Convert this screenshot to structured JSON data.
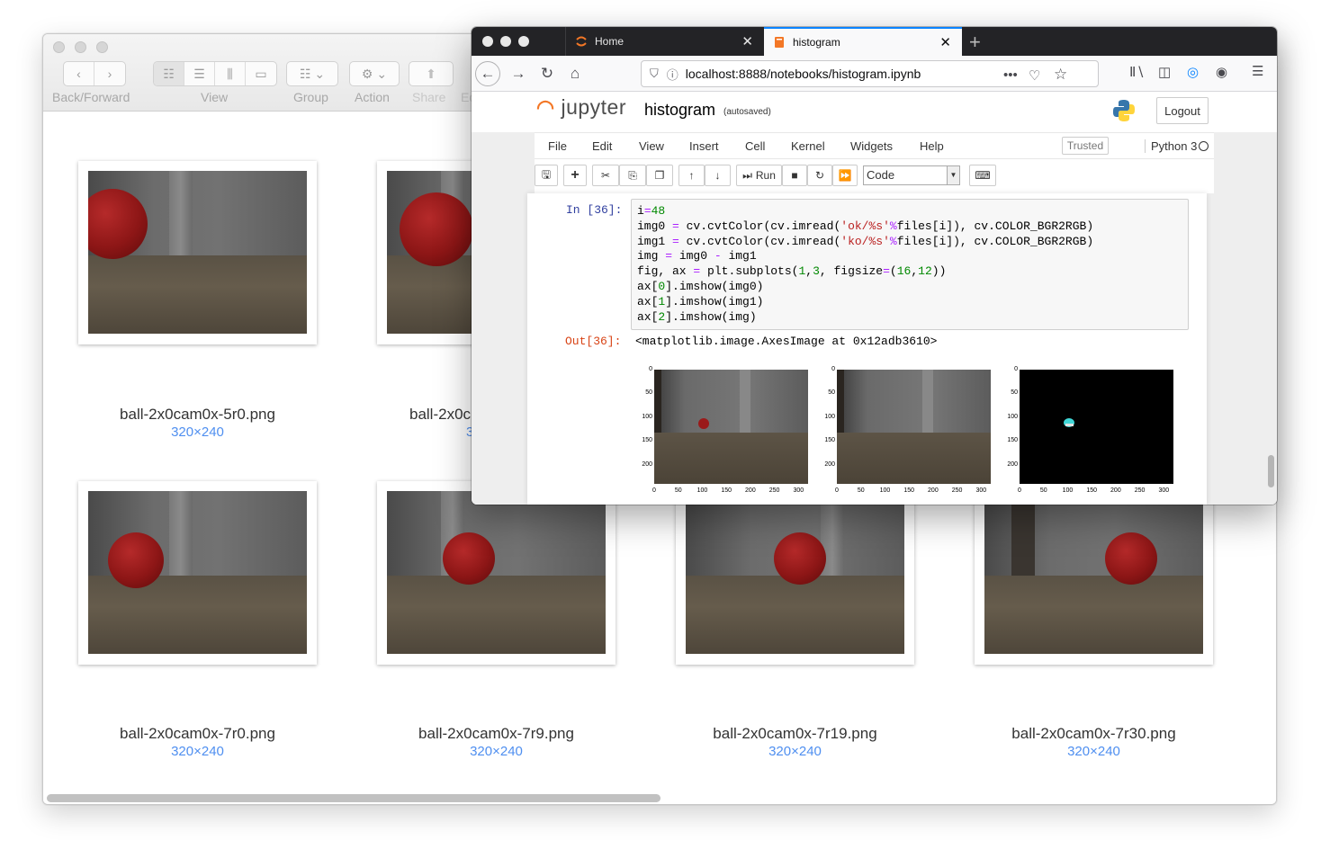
{
  "finder": {
    "toolbar": {
      "back_forward_label": "Back/Forward",
      "view_label": "View",
      "group_label": "Group",
      "action_label": "Action",
      "share_label": "Share",
      "edit_tags_label": "Ed"
    },
    "files": [
      {
        "name": "ball-2x0cam0x-5r0.png",
        "size": "320×240"
      },
      {
        "name": "ball-2x0c",
        "size": "3"
      },
      {
        "name": "ball-2x0cam0x-7r0.png",
        "size": "320×240"
      },
      {
        "name": "ball-2x0cam0x-7r9.png",
        "size": "320×240"
      },
      {
        "name": "ball-2x0cam0x-7r19.png",
        "size": "320×240"
      },
      {
        "name": "ball-2x0cam0x-7r30.png",
        "size": "320×240"
      }
    ]
  },
  "browser": {
    "tabs": [
      {
        "label": "Home",
        "icon": "jupyter-icon"
      },
      {
        "label": "histogram",
        "icon": "notebook-icon"
      }
    ],
    "url": "localhost:8888/notebooks/histogram.ipynb",
    "new_tab_icon": "+"
  },
  "jupyter": {
    "logo_text": "jupyter",
    "notebook_title": "histogram",
    "save_status": "(autosaved)",
    "logout_label": "Logout",
    "menu": [
      "File",
      "Edit",
      "View",
      "Insert",
      "Cell",
      "Kernel",
      "Widgets",
      "Help"
    ],
    "trusted_label": "Trusted",
    "kernel_name": "Python 3",
    "run_label": "Run",
    "cell_type": "Code",
    "in_prompt": "In [36]:",
    "out_prompt": "Out[36]:",
    "output_text": "<matplotlib.image.AxesImage at 0x12adb3610>",
    "code_lines": [
      "i=48",
      "img0 = cv.cvtColor(cv.imread('ok/%s'%files[i]), cv.COLOR_BGR2RGB)",
      "img1 = cv.cvtColor(cv.imread('ko/%s'%files[i]), cv.COLOR_BGR2RGB)",
      "img = img0 - img1",
      "fig, ax = plt.subplots(1,3, figsize=(16,12))",
      "ax[0].imshow(img0)",
      "ax[1].imshow(img1)",
      "ax[2].imshow(img)"
    ],
    "plot_y_ticks": [
      "0",
      "50",
      "100",
      "150",
      "200"
    ],
    "plot_x_ticks": [
      "0",
      "50",
      "100",
      "150",
      "200",
      "250",
      "300"
    ]
  }
}
